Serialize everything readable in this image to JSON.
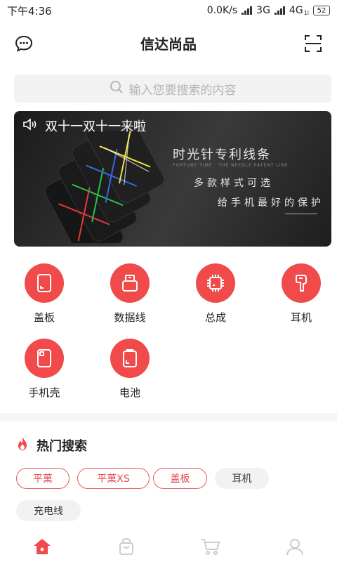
{
  "status": {
    "time": "下午4:36",
    "speed": "0.0K/s",
    "net1": "3G",
    "net2": "4G",
    "net2_sub": "1l",
    "battery": "52"
  },
  "header": {
    "title": "信达尚品",
    "left_icon": "chat-bubble-icon",
    "right_icon": "scan-icon"
  },
  "search": {
    "placeholder": "输入您要搜索的内容",
    "icon": "search-icon"
  },
  "banner": {
    "notice": "双十一双十一来啦",
    "tagline1": "时光针专利线条",
    "tagline_sub": "FORTUNE TIME · THE NEEDLE PATENT LINE",
    "tagline2": "多款样式可选",
    "tagline3": "给手机最好的保护",
    "notice_icon": "speaker-icon"
  },
  "categories": [
    {
      "label": "盖板",
      "icon": "cover-plate-icon"
    },
    {
      "label": "数据线",
      "icon": "data-cable-icon"
    },
    {
      "label": "总成",
      "icon": "chip-assembly-icon"
    },
    {
      "label": "耳机",
      "icon": "earphone-icon"
    },
    {
      "label": "手机壳",
      "icon": "phone-case-icon"
    },
    {
      "label": "电池",
      "icon": "battery-icon"
    }
  ],
  "hot_search": {
    "title": "热门搜索",
    "icon": "flame-icon",
    "tags": [
      {
        "label": "平菓",
        "style": "red"
      },
      {
        "label": "平菓XS",
        "style": "red"
      },
      {
        "label": "盖板",
        "style": "red"
      },
      {
        "label": "耳机",
        "style": "gray"
      },
      {
        "label": "充电线",
        "style": "gray"
      }
    ]
  },
  "tabbar": [
    {
      "icon": "home-icon",
      "active": true
    },
    {
      "icon": "shopping-bag-icon",
      "active": false
    },
    {
      "icon": "cart-icon",
      "active": false
    },
    {
      "icon": "user-icon",
      "active": false
    }
  ],
  "colors": {
    "accent": "#f04a4a",
    "tag_border": "#e85a5a",
    "search_bg": "#f2f2f2",
    "inactive_icon": "#cccccc"
  }
}
